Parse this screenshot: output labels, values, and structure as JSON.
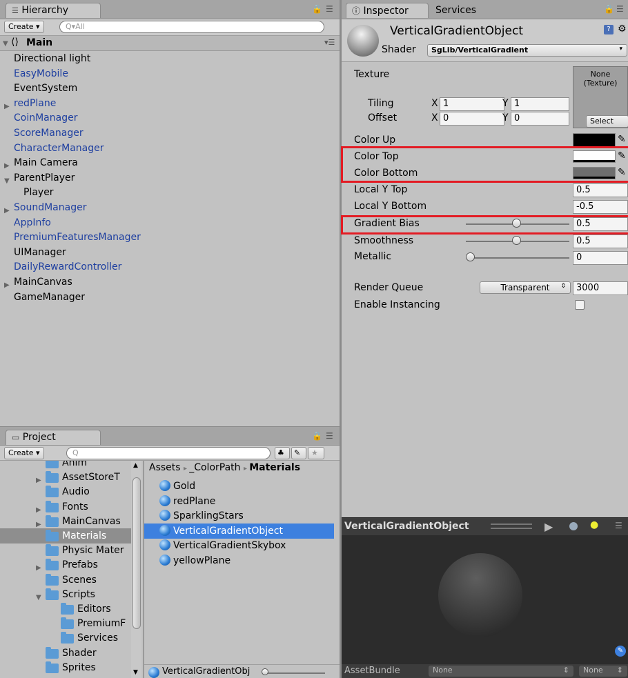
{
  "hierarchy": {
    "tab_label": "Hierarchy",
    "create_label": "Create",
    "search_placeholder": "Q▾All",
    "scene_name": "Main",
    "items": [
      {
        "label": "Directional light",
        "color": "black",
        "indent": 1,
        "fold": ""
      },
      {
        "label": "EasyMobile",
        "color": "blue",
        "indent": 1,
        "fold": ""
      },
      {
        "label": "EventSystem",
        "color": "black",
        "indent": 1,
        "fold": ""
      },
      {
        "label": "redPlane",
        "color": "blue",
        "indent": 1,
        "fold": "▶"
      },
      {
        "label": "CoinManager",
        "color": "blue",
        "indent": 1,
        "fold": ""
      },
      {
        "label": "ScoreManager",
        "color": "blue",
        "indent": 1,
        "fold": ""
      },
      {
        "label": "CharacterManager",
        "color": "blue",
        "indent": 1,
        "fold": ""
      },
      {
        "label": "Main Camera",
        "color": "black",
        "indent": 1,
        "fold": "▶"
      },
      {
        "label": "ParentPlayer",
        "color": "black",
        "indent": 1,
        "fold": "▼"
      },
      {
        "label": "Player",
        "color": "black",
        "indent": 2,
        "fold": ""
      },
      {
        "label": "SoundManager",
        "color": "blue",
        "indent": 1,
        "fold": "▶"
      },
      {
        "label": "AppInfo",
        "color": "blue",
        "indent": 1,
        "fold": ""
      },
      {
        "label": "PremiumFeaturesManager",
        "color": "blue",
        "indent": 1,
        "fold": ""
      },
      {
        "label": "UIManager",
        "color": "black",
        "indent": 1,
        "fold": ""
      },
      {
        "label": "DailyRewardController",
        "color": "blue",
        "indent": 1,
        "fold": ""
      },
      {
        "label": "MainCanvas",
        "color": "black",
        "indent": 1,
        "fold": "▶"
      },
      {
        "label": "GameManager",
        "color": "black",
        "indent": 1,
        "fold": ""
      }
    ]
  },
  "project": {
    "tab_label": "Project",
    "create_label": "Create",
    "folders": [
      {
        "label": "Anim",
        "fold": "",
        "indent": 1
      },
      {
        "label": "AssetStoreT",
        "fold": "▶",
        "indent": 1
      },
      {
        "label": "Audio",
        "fold": "",
        "indent": 1
      },
      {
        "label": "Fonts",
        "fold": "▶",
        "indent": 1
      },
      {
        "label": "MainCanvas",
        "fold": "▶",
        "indent": 1
      },
      {
        "label": "Materials",
        "fold": "",
        "indent": 1
      },
      {
        "label": "Physic Mater",
        "fold": "",
        "indent": 1
      },
      {
        "label": "Prefabs",
        "fold": "▶",
        "indent": 1
      },
      {
        "label": "Scenes",
        "fold": "",
        "indent": 1
      },
      {
        "label": "Scripts",
        "fold": "▼",
        "indent": 1
      },
      {
        "label": "Editors",
        "fold": "",
        "indent": 2
      },
      {
        "label": "PremiumF",
        "fold": "",
        "indent": 2
      },
      {
        "label": "Services",
        "fold": "",
        "indent": 2
      },
      {
        "label": "Shader",
        "fold": "",
        "indent": 1
      },
      {
        "label": "Sprites",
        "fold": "",
        "indent": 1
      }
    ],
    "breadcrumb": {
      "assets": "Assets",
      "colorpath": "_ColorPath",
      "materials": "Materials"
    },
    "assets": [
      "Gold",
      "redPlane",
      "SparklingStars",
      "VerticalGradientObject",
      "VerticalGradientSkybox",
      "yellowPlane"
    ],
    "bottom_selected": "VerticalGradientObj"
  },
  "inspector": {
    "tab_label": "Inspector",
    "services_label": "Services",
    "object_name": "VerticalGradientObject",
    "shader_label": "Shader",
    "shader_value": "SgLib/VerticalGradient",
    "texture_label": "Texture",
    "texture_none": "None\n(Texture)",
    "texture_select": "Select",
    "tiling_label": "Tiling",
    "offset_label": "Offset",
    "x_label": "X",
    "y_label": "Y",
    "tiling_x": "1",
    "tiling_y": "1",
    "offset_x": "0",
    "offset_y": "0",
    "color_up_label": "Color Up",
    "color_top_label": "Color Top",
    "color_bottom_label": "Color Bottom",
    "color_up": "#000000",
    "color_top": "#ffffff",
    "color_bottom": "#6e6e6e",
    "local_y_top_label": "Local Y Top",
    "local_y_top": "0.5",
    "local_y_bottom_label": "Local Y Bottom",
    "local_y_bottom": "-0.5",
    "gradient_bias_label": "Gradient Bias",
    "gradient_bias": "0.5",
    "smoothness_label": "Smoothness",
    "smoothness": "0.5",
    "metallic_label": "Metallic",
    "metallic": "0",
    "render_queue_label": "Render Queue",
    "render_queue_mode": "Transparent",
    "render_queue_value": "3000",
    "enable_instancing_label": "Enable Instancing"
  },
  "preview": {
    "title": "VerticalGradientObject",
    "assetbundle_label": "AssetBundle",
    "assetbundle_value": "None",
    "assetbundle_variant": "None"
  }
}
